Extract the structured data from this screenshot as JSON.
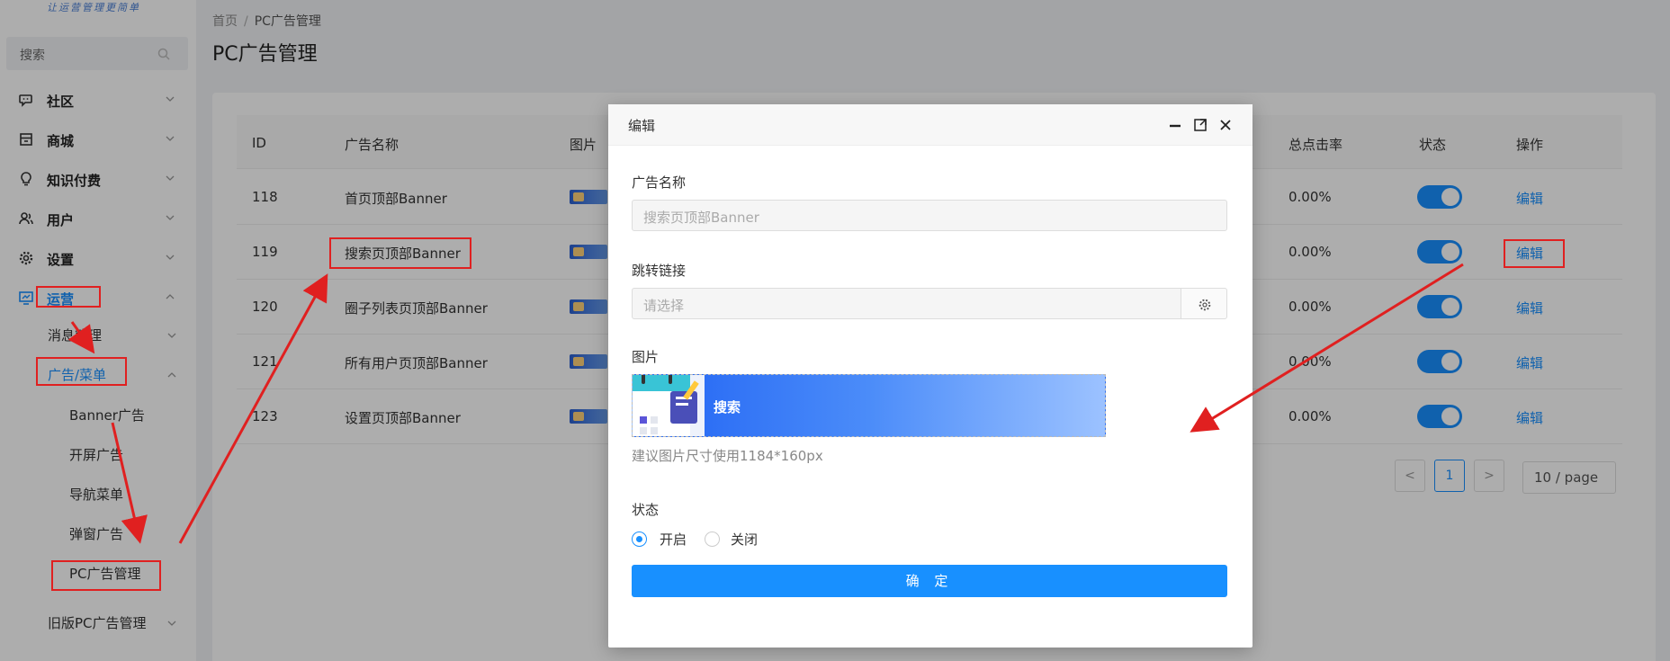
{
  "sidebar": {
    "logo_text": "让运营管理更简单",
    "search_placeholder": "搜索",
    "items": [
      {
        "label": "社区"
      },
      {
        "label": "商城"
      },
      {
        "label": "知识付费"
      },
      {
        "label": "用户"
      },
      {
        "label": "设置"
      },
      {
        "label": "运营"
      }
    ],
    "sub_items": [
      {
        "label": "消息管理"
      },
      {
        "label": "广告/菜单"
      },
      {
        "label": "Banner广告"
      },
      {
        "label": "开屏广告"
      },
      {
        "label": "导航菜单"
      },
      {
        "label": "弹窗广告"
      },
      {
        "label": "PC广告管理"
      },
      {
        "label": "旧版PC广告管理"
      }
    ]
  },
  "breadcrumb": {
    "home": "首页",
    "sep": "/",
    "current": "PC广告管理"
  },
  "page_title": "PC广告管理",
  "table": {
    "headers": {
      "id": "ID",
      "name": "广告名称",
      "image": "图片",
      "ctr": "总点击率",
      "status": "状态",
      "action": "操作"
    },
    "rows": [
      {
        "id": "118",
        "name": "首页顶部Banner",
        "ctr": "0.00%",
        "action": "编辑"
      },
      {
        "id": "119",
        "name": "搜索页顶部Banner",
        "ctr": "0.00%",
        "action": "编辑"
      },
      {
        "id": "120",
        "name": "圈子列表页顶部Banner",
        "ctr": "0.00%",
        "action": "编辑"
      },
      {
        "id": "121",
        "name": "所有用户页顶部Banner",
        "ctr": "0.00%",
        "action": "编辑"
      },
      {
        "id": "123",
        "name": "设置页顶部Banner",
        "ctr": "0.00%",
        "action": "编辑"
      }
    ]
  },
  "pagination": {
    "prev": "<",
    "page": "1",
    "next": ">",
    "size": "10 / page"
  },
  "modal": {
    "title": "编辑",
    "name_label": "广告名称",
    "name_value": "搜索页顶部Banner",
    "link_label": "跳转链接",
    "link_placeholder": "请选择",
    "image_label": "图片",
    "banner_text": "搜索",
    "image_hint": "建议图片尺寸使用1184*160px",
    "status_label": "状态",
    "status_on": "开启",
    "status_off": "关闭",
    "confirm": "确 定"
  },
  "colors": {
    "accent": "#1890ff",
    "annotation": "#e02020"
  }
}
